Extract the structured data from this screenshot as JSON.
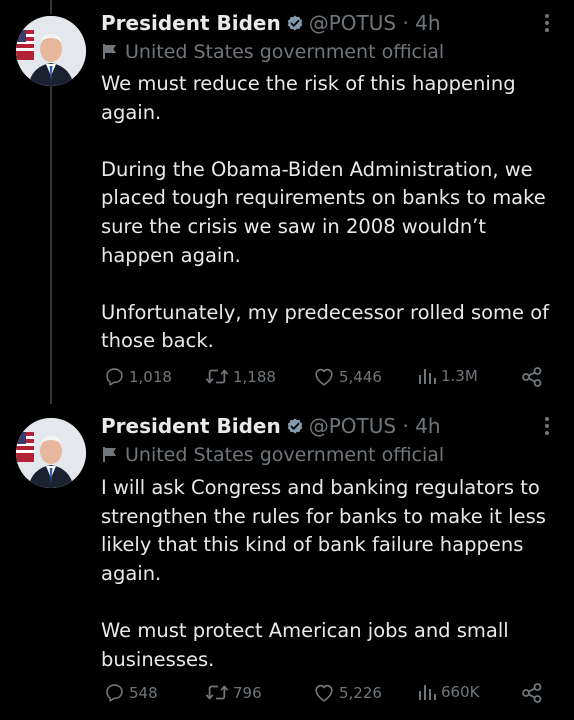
{
  "tweets": [
    {
      "name": "President Biden",
      "handle": "@POTUS",
      "separator": "·",
      "time": "4h",
      "label": "United States government official",
      "paragraphs": [
        "We must reduce the risk of this happening again.",
        "During the Obama-Biden Administration, we placed tough requirements on banks to make sure the crisis we saw in 2008 wouldn’t happen again.",
        "Unfortunately, my predecessor rolled some of those back."
      ],
      "replies": "1,018",
      "retweets": "1,188",
      "likes": "5,446",
      "views": "1.3M"
    },
    {
      "name": "President Biden",
      "handle": "@POTUS",
      "separator": "·",
      "time": "4h",
      "label": "United States government official",
      "paragraphs": [
        "I will ask Congress and banking regulators to strengthen the rules for banks to make it less likely that this kind of bank failure happens again.",
        "We must protect American jobs and small businesses."
      ],
      "replies": "548",
      "retweets": "796",
      "likes": "5,226",
      "views": "660K"
    }
  ],
  "icons": {
    "verified": "verified-badge-icon",
    "label": "flag-icon",
    "more": "more-options-icon",
    "reply": "reply-icon",
    "retweet": "retweet-icon",
    "like": "heart-icon",
    "views": "views-icon",
    "share": "share-icon"
  },
  "colors": {
    "background": "#000000",
    "text": "#e7e9ea",
    "secondary": "#71767b",
    "badge": "#829aab"
  }
}
